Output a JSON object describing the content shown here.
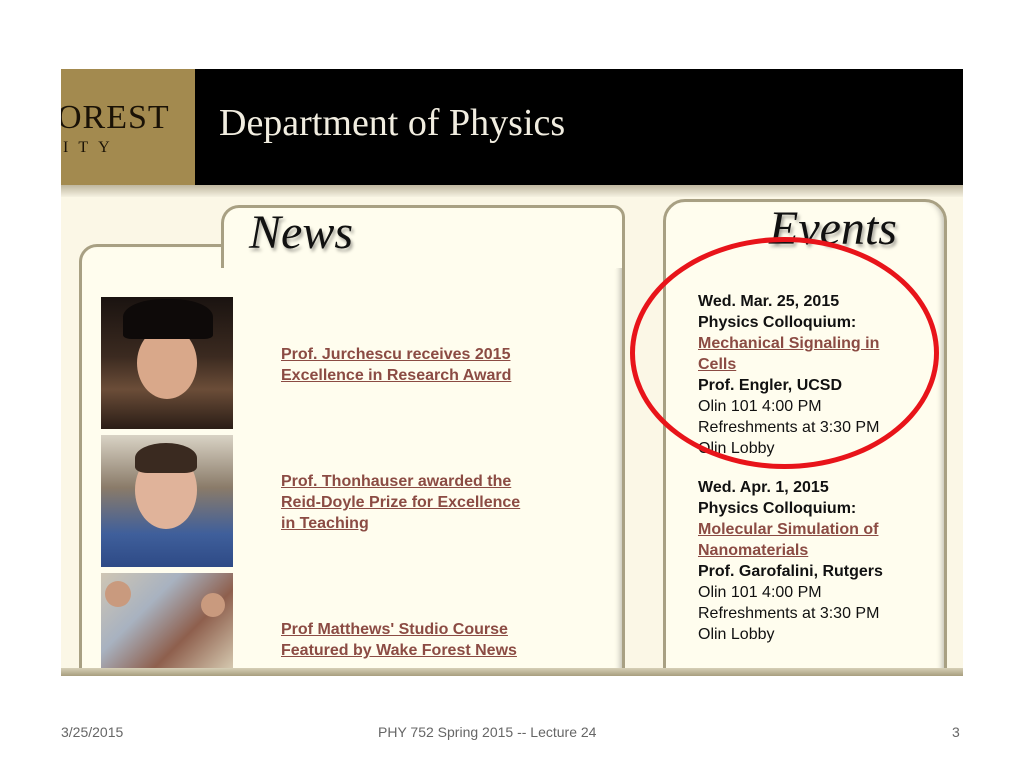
{
  "header": {
    "logo_line1": "OREST",
    "logo_line2": "ITY",
    "title": "Department of Physics"
  },
  "news": {
    "heading": "News",
    "items": [
      {
        "lines": [
          "Prof. Jurchescu receives 2015",
          "Excellence in Research Award"
        ]
      },
      {
        "lines": [
          "Prof. Thonhauser awarded the",
          "Reid-Doyle Prize for Excellence",
          "in Teaching"
        ]
      },
      {
        "lines": [
          "Prof Matthews' Studio Course",
          "Featured by Wake Forest News"
        ]
      }
    ]
  },
  "events": {
    "heading": "Events",
    "items": [
      {
        "date": "Wed. Mar. 25, 2015",
        "type": "Physics Colloquium:",
        "title_lines": [
          "Mechanical Signaling in",
          "Cells"
        ],
        "speaker": "Prof. Engler, UCSD",
        "details": [
          "Olin 101 4:00 PM",
          "Refreshments at 3:30 PM",
          "Olin Lobby"
        ]
      },
      {
        "date": "Wed. Apr. 1, 2015",
        "type": "Physics Colloquium:",
        "title_lines": [
          "Molecular Simulation of",
          "Nanomaterials"
        ],
        "speaker": "Prof. Garofalini, Rutgers",
        "details": [
          "Olin 101 4:00 PM",
          "Refreshments at 3:30 PM",
          "Olin Lobby"
        ]
      }
    ]
  },
  "annotation": {
    "color": "#e8141a"
  },
  "footer": {
    "date": "3/25/2015",
    "course": "PHY 752  Spring 2015 -- Lecture 24",
    "slide_number": "3"
  }
}
